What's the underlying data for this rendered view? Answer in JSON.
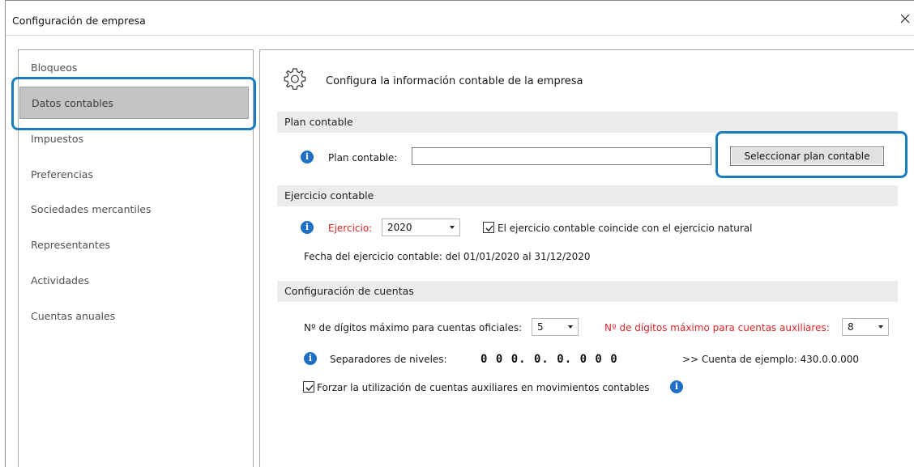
{
  "window": {
    "title": "Configuración de empresa"
  },
  "sidebar": {
    "items": [
      {
        "label": "Bloqueos"
      },
      {
        "label": "Datos contables"
      },
      {
        "label": "Impuestos"
      },
      {
        "label": "Preferencias"
      },
      {
        "label": "Sociedades mercantiles"
      },
      {
        "label": "Representantes"
      },
      {
        "label": "Actividades"
      },
      {
        "label": "Cuentas anuales"
      }
    ],
    "selected": "Datos contables"
  },
  "panel": {
    "title": "Configura la información contable de la empresa",
    "icon": "gear-icon",
    "plan": {
      "section": "Plan contable",
      "label": "Plan contable:",
      "value": "",
      "button": "Seleccionar plan contable"
    },
    "ejercicio": {
      "section": "Ejercicio contable",
      "label": "Ejercicio:",
      "value": "2020",
      "checkbox_label": "El ejercicio contable coincide con el ejercicio natural",
      "checkbox_checked": true,
      "fecha": "Fecha del ejercicio contable: del 01/01/2020 al 31/12/2020"
    },
    "cuentas": {
      "section": "Configuración de cuentas",
      "oficiales_label": "Nº de dígitos máximo para cuentas oficiales:",
      "oficiales_value": "5",
      "auxiliares_label": "Nº de dígitos máximo para cuentas auxiliares:",
      "auxiliares_value": "8",
      "separadores_label": "Separadores de niveles:",
      "separadores_value": "0 0 0. 0. 0. 0 0 0",
      "ejemplo": ">> Cuenta de ejemplo: 430.0.0.000",
      "forzar_label": "Forzar la utilización de cuentas auxiliares en movimientos contables",
      "forzar_checked": true
    }
  },
  "colors": {
    "accent": "#1a7dc1",
    "info": "#1f6fc5",
    "required_label": "#d8262b",
    "selected_nav": "#c4c4c4",
    "section_header": "#ececec"
  }
}
